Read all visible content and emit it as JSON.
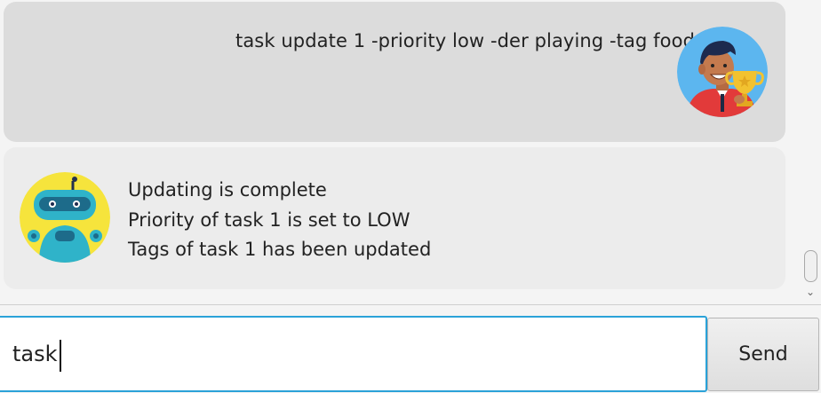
{
  "chat": {
    "user_message": "task update 1 -priority low -der playing -tag food",
    "bot_response": {
      "lines": [
        "Updating is complete",
        "Priority of task 1 is set to LOW",
        "Tags of task 1 has been updated"
      ]
    },
    "user_avatar_icon": "person-with-trophy-icon",
    "bot_avatar_icon": "robot-icon"
  },
  "input": {
    "value": "task"
  },
  "send_button": {
    "label": "Send"
  },
  "colors": {
    "user_bubble": "#dcdcdc",
    "bot_bubble": "#ececec",
    "input_focus_border": "#2aa2d8"
  }
}
